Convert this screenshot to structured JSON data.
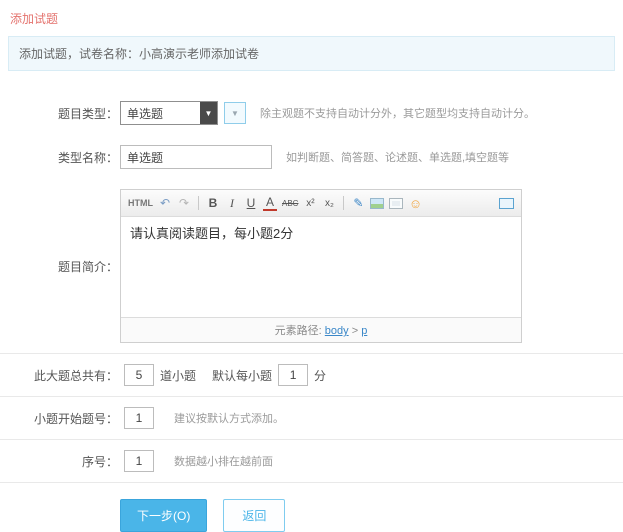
{
  "theme": {
    "accent": "#4ab5e8",
    "title_color": "#e4736e",
    "info_bg": "#f0f8fc"
  },
  "page": {
    "title": "添加试题"
  },
  "info_bar": {
    "text": "添加试题，试卷名称：小高演示老师添加试卷"
  },
  "icons": {
    "select_arrow": "▼",
    "dropdown_arrow": "▼"
  },
  "form": {
    "question_type": {
      "label": "题目类型：",
      "value": "单选题",
      "hint": "除主观题不支持自动计分外，其它题型均支持自动计分。"
    },
    "type_name": {
      "label": "类型名称：",
      "value": "单选题",
      "hint": "如判断题、简答题、论述题、单选题,填空题等"
    },
    "intro": {
      "label": "题目简介：",
      "content": "请认真阅读题目，每小题2分",
      "status_prefix": "元素路径: ",
      "status_node1": "body",
      "status_sep": " > ",
      "status_node2": "p"
    },
    "total": {
      "label": "此大题总共有：",
      "count_value": "5",
      "count_suffix": "道小题",
      "per_label": "默认每小题",
      "score_value": "1",
      "score_suffix": "分"
    },
    "start_number": {
      "label": "小题开始题号：",
      "value": "1",
      "hint": "建议按默认方式添加。"
    },
    "sequence": {
      "label": "序号：",
      "value": "1",
      "hint": "数据越小排在越前面"
    }
  },
  "editor_toolbar": {
    "html": "HTML",
    "undo": "↶",
    "redo": "↷",
    "bold": "B",
    "italic": "I",
    "underline": "U",
    "font_color": "A",
    "strikethrough": "ABC",
    "superscript": "x²",
    "subscript": "x₂",
    "remove_format": "✎",
    "emoticon": "☺"
  },
  "buttons": {
    "next": "下一步(O)",
    "back": "返回"
  }
}
